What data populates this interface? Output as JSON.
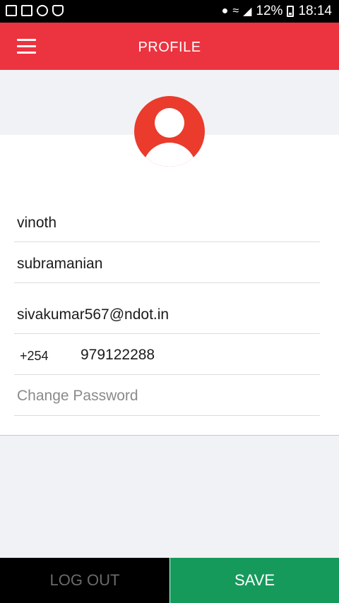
{
  "status_bar": {
    "left_icons": [
      "image-notification-icon",
      "gmail-icon",
      "vpn-icon",
      "shield-icon"
    ],
    "right_icons": [
      "location-icon",
      "wifi-icon",
      "signal-icon"
    ],
    "battery": "12%",
    "time": "18:14"
  },
  "app_bar": {
    "title": "PROFILE",
    "menu_icon": "hamburger-menu-icon",
    "color": "#ec3340"
  },
  "profile": {
    "avatar_icon": "user-avatar-icon",
    "avatar_color": "#ea3b2c",
    "first_name": "vinoth",
    "last_name": "subramanian",
    "email": "sivakumar567@ndot.in",
    "phone_code": "+254",
    "phone_number": "979122288",
    "change_password": "Change Password"
  },
  "actions": {
    "logout": "LOG OUT",
    "save": "SAVE",
    "save_color": "#159a5c"
  }
}
